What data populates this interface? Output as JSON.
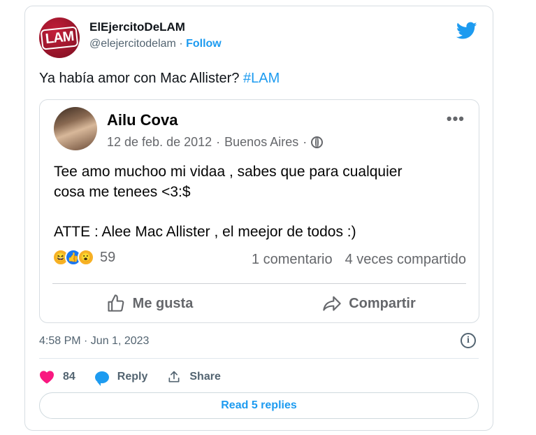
{
  "tweet": {
    "author_name": "ElEjercitoDeLAM",
    "author_handle": "@elejercitodelam",
    "separator": "·",
    "follow_label": "Follow",
    "avatar_text": "LAM",
    "text": "Ya había amor con Mac Allister? ",
    "hashtag": "#LAM",
    "timestamp": "4:58 PM · Jun 1, 2023",
    "likes": "84",
    "reply_label": "Reply",
    "share_label": "Share",
    "read_replies_label": "Read 5 replies",
    "brand_color": "#1d9bf0",
    "like_color": "#f91880"
  },
  "fb_post": {
    "author": "Ailu Cova",
    "date": "12 de feb. de 2012",
    "location": "Buenos Aires",
    "dot": "·",
    "body": "Tee amo muchoo mi vidaa , sabes que para cualquier\ncosa me tenees <3:$",
    "signature": "ATTE : Alee Mac Allister , el meejor de todos :)",
    "reaction_count": "59",
    "comments": "1 comentario",
    "shares": "4 veces compartido",
    "like_label": "Me gusta",
    "share_label": "Compartir",
    "more_label": "•••",
    "reactions": [
      "haha-icon",
      "like-icon",
      "wow-icon"
    ]
  }
}
